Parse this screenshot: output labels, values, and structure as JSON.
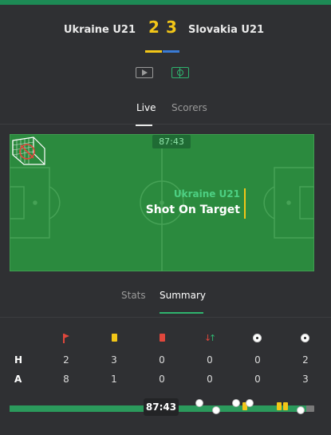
{
  "match": {
    "home_team": "Ukraine U21",
    "away_team": "Slovakia U21",
    "home_score": "2",
    "away_score": "3",
    "home_color": "#f2c618",
    "away_color": "#3a7bd5"
  },
  "media_icons": [
    "play-video-icon",
    "pitch-view-icon"
  ],
  "tabs": [
    {
      "label": "Live",
      "active": true
    },
    {
      "label": "Scorers",
      "active": false
    }
  ],
  "live": {
    "clock": "87:43",
    "event_team": "Ukraine U21",
    "event_text": "Shot On Target"
  },
  "subtabs": [
    {
      "label": "Stats",
      "active": false
    },
    {
      "label": "Summary",
      "active": true
    }
  ],
  "summary": {
    "icons": [
      "corner-flag-icon",
      "yellow-card-icon",
      "red-card-icon",
      "substitution-icon",
      "ball-icon",
      "ball-icon"
    ],
    "rows": [
      {
        "label": "H",
        "values": [
          "2",
          "3",
          "0",
          "0",
          "0",
          "2"
        ]
      },
      {
        "label": "A",
        "values": [
          "8",
          "1",
          "0",
          "0",
          "0",
          "3"
        ]
      }
    ]
  },
  "timeline": {
    "clock": "87:43",
    "progress": 0.975,
    "events": [
      {
        "type": "goal",
        "minute": 56
      },
      {
        "type": "goal",
        "minute": 61
      },
      {
        "type": "goal",
        "minute": 67
      },
      {
        "type": "yellow",
        "minute": 70
      },
      {
        "type": "goal",
        "minute": 71
      },
      {
        "type": "yellow",
        "minute": 80
      },
      {
        "type": "yellow",
        "minute": 82
      },
      {
        "type": "goal",
        "minute": 86
      }
    ]
  }
}
